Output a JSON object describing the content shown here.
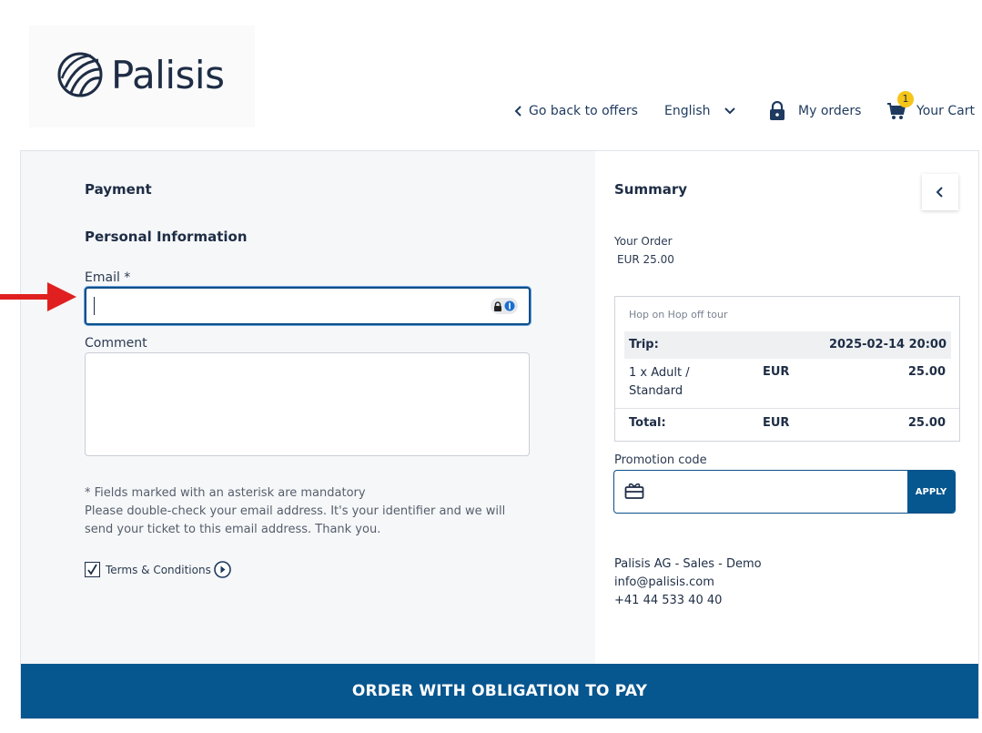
{
  "brand": {
    "name": "Palisis"
  },
  "nav": {
    "back_label": "Go back to offers",
    "language": "English",
    "my_orders": "My orders",
    "cart_label": "Your Cart",
    "cart_count": "1"
  },
  "form": {
    "section_title": "Payment",
    "subsection_title": "Personal Information",
    "email_label": "Email *",
    "email_value": "",
    "comment_label": "Comment",
    "comment_value": "",
    "mandatory_note": "* Fields marked with an asterisk are mandatory",
    "email_note": "Please double-check your email address. It's your identifier and we will send your ticket to this email address. Thank you.",
    "terms_label": "Terms & Conditions",
    "terms_checked": true
  },
  "summary": {
    "title": "Summary",
    "your_order_label": "Your Order",
    "order_total": "EUR 25.00",
    "tour_name": "Hop on Hop off tour",
    "trip_label": "Trip:",
    "trip_datetime": "2025-02-14 20:00",
    "item_description": "1 x Adult / Standard",
    "item_currency": "EUR",
    "item_amount": "25.00",
    "total_label": "Total:",
    "total_currency": "EUR",
    "total_amount": "25.00"
  },
  "promo": {
    "label": "Promotion code",
    "value": "",
    "apply_label": "APPLY"
  },
  "contact": {
    "company": "Palisis AG - Sales - Demo",
    "email": "info@palisis.com",
    "phone": "+41 44 533 40 40"
  },
  "footer": {
    "order_button": "ORDER WITH OBLIGATION TO PAY"
  },
  "colors": {
    "primary": "#06568f",
    "text_dark": "#1e2d45",
    "badge": "#f5c518",
    "annotation_arrow": "#e02020"
  }
}
